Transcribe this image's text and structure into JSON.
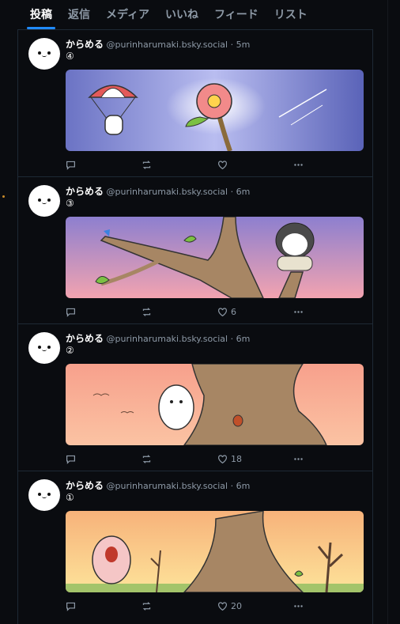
{
  "tabs": [
    "投稿",
    "返信",
    "メディア",
    "いいね",
    "フィード",
    "リスト"
  ],
  "posts": [
    {
      "name": "からめる",
      "handle": "@purinharumaki.bsky.social",
      "time": "5m",
      "text": "④",
      "likes": ""
    },
    {
      "name": "からめる",
      "handle": "@purinharumaki.bsky.social",
      "time": "6m",
      "text": "③",
      "likes": "6"
    },
    {
      "name": "からめる",
      "handle": "@purinharumaki.bsky.social",
      "time": "6m",
      "text": "②",
      "likes": "18"
    },
    {
      "name": "からめる",
      "handle": "@purinharumaki.bsky.social",
      "time": "6m",
      "text": "①",
      "likes": "20"
    }
  ],
  "separator": "·",
  "icons": {
    "reply": "reply-icon",
    "repost": "repost-icon",
    "like": "heart-icon",
    "more": "more-icon"
  },
  "colors": {
    "background": "#0a0c10",
    "accent": "#208bfe",
    "muted": "#8d99a6"
  }
}
